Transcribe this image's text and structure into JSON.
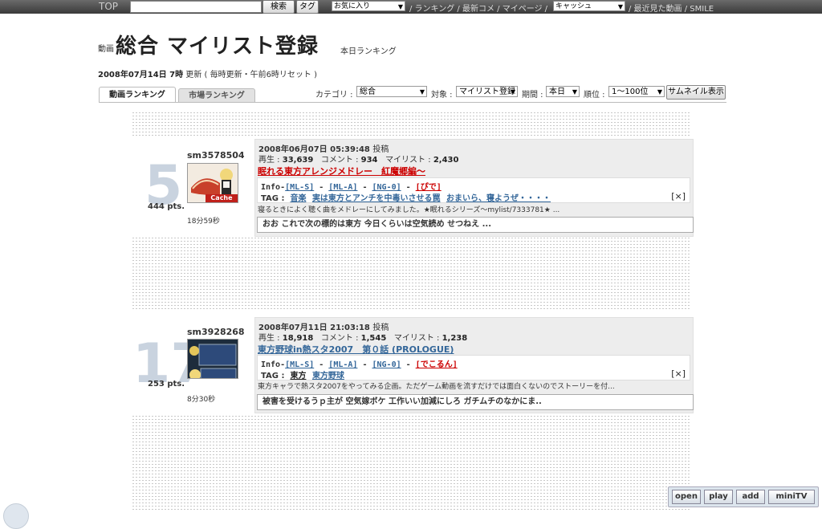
{
  "topbar": {
    "top": "TOP",
    "search_button": "検索",
    "tag_button": "タグ",
    "favorites_select": "お気に入り",
    "nav_links": "/ ランキング / 最新コメ / マイページ /",
    "cache_select": "キャッシュ",
    "nav_links_2": "/ 最近見た動画 / SMILE"
  },
  "header": {
    "prefix": "動画",
    "title": "総合 マイリスト登録",
    "suffix": "本日ランキング",
    "update_date": "2008年07月14日 7時",
    "update_label": "更新",
    "update_note": "( 毎時更新・午前6時リセット )"
  },
  "tabs": [
    "動画ランキング",
    "市場ランキング"
  ],
  "filters": {
    "category_label": "カテゴリ :",
    "category_value": "総合",
    "target_label": "対象 :",
    "target_value": "マイリスト登録",
    "period_label": "期間 :",
    "period_value": "本日",
    "rank_label": "順位 :",
    "rank_value": "1〜100位",
    "thumb_button": "サムネイル表示"
  },
  "entries": [
    {
      "rank": "5",
      "points": "444 pts.",
      "id": "sm3578504",
      "duration": "18分59秒",
      "posted_date": "2008年06月07日 05:39:48",
      "posted_label": "投稿",
      "plays_label": "再生 :",
      "plays": "33,639",
      "comments_label": "コメント :",
      "comments": "934",
      "mylist_label": "マイリスト :",
      "mylist": "2,430",
      "title": "眠れる東方アレンジメドレー　紅魔郷編〜",
      "info_label": "Info-",
      "info_links": [
        "[ML-S]",
        "[ML-A]",
        "[NG-0]",
        "[ぴで]"
      ],
      "tag_label": "TAG :",
      "tags": [
        "音楽",
        "実は東方とアンチを中毒いさせる罠",
        "おまいら、寝ようぜ・・・・"
      ],
      "close": "[×]",
      "description": "寝るときによく聴く曲をメドレーにしてみました。★眠れるシリーズ〜mylist/7333781★ ...",
      "comment": "おお これで次の標的は東方 今日くらいは空気読め せつねえ ...",
      "cache_label": "Cache"
    },
    {
      "rank": "17",
      "points": "253 pts.",
      "id": "sm3928268",
      "duration": "8分30秒",
      "posted_date": "2008年07月11日 21:03:18",
      "posted_label": "投稿",
      "plays_label": "再生 :",
      "plays": "18,918",
      "comments_label": "コメント :",
      "comments": "1,545",
      "mylist_label": "マイリスト :",
      "mylist": "1,238",
      "title": "東方野球in熱スタ2007　第０話 (PROLOGUE)",
      "info_label": "Info-",
      "info_links": [
        "[ML-S]",
        "[ML-A]",
        "[NG-0]",
        "[でこるん]"
      ],
      "tag_label": "TAG :",
      "tags": [
        "東方",
        "東方野球"
      ],
      "close": "[×]",
      "description": "東方キャラで熱スタ2007をやってみる企画。ただゲーム動画を流すだけでは面白くないのでストーリーを付...",
      "comment": "被害を受けるうｐ主が 空気嫁ボケ 工作いい加減にしろ ガチムチのなかにま.."
    }
  ],
  "bottom_buttons": [
    "open",
    "play",
    "add",
    "miniTV"
  ]
}
